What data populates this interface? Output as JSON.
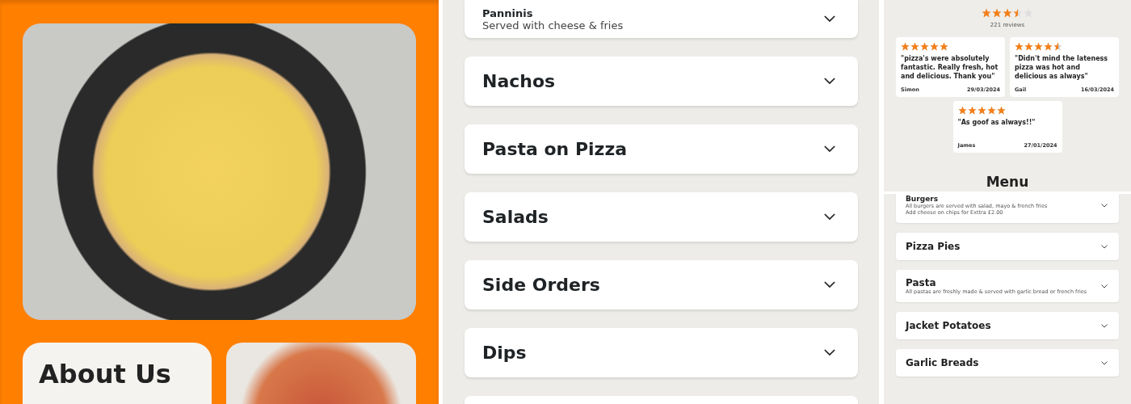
{
  "hero": {
    "about_title": "About Us"
  },
  "menu_categories": [
    {
      "title": "Panninis",
      "subtitle": "Served with cheese & fries",
      "expanded": false
    },
    {
      "title": "Nachos",
      "expanded": false
    },
    {
      "title": "Pasta on Pizza",
      "expanded": false
    },
    {
      "title": "Salads",
      "expanded": false
    },
    {
      "title": "Side Orders",
      "expanded": false
    },
    {
      "title": "Dips",
      "expanded": false
    }
  ],
  "reviews_summary": {
    "stars": 3.5,
    "count": "221 reviews"
  },
  "reviews": [
    {
      "stars": 5,
      "text": "\"pizza's were absolutely fantastic. Really fresh, hot and delicious. Thank you\"",
      "author": "Simon",
      "date": "29/03/2024"
    },
    {
      "stars": 4.5,
      "text": "\"Didn't mind the lateness pizza was hot and delicious as always\"",
      "author": "Gail",
      "date": "16/03/2024"
    },
    {
      "stars": 5,
      "text": "\"As goof as always!!\"",
      "author": "James",
      "date": "27/01/2024"
    }
  ],
  "menu_heading": "Menu",
  "mobile_menu": [
    {
      "title": "Burgers",
      "notes": [
        "All burgers are served with salad, mayo & french fries",
        "Add cheese on chips for Exttra £2.00"
      ]
    },
    {
      "title": "Pizza Pies"
    },
    {
      "title": "Pasta",
      "notes": [
        "All pastas are freshly made & served with garlic bread or french fries"
      ]
    },
    {
      "title": "Jacket Potatoes"
    },
    {
      "title": "Garlic Breads"
    }
  ]
}
